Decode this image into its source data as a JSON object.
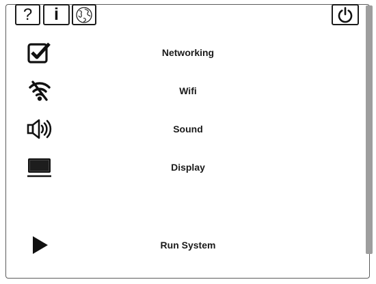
{
  "toolbar": {
    "help_label": "?",
    "info_label": "i"
  },
  "icons": {
    "help": "question-mark-icon",
    "info": "info-icon",
    "language": "globe-icon",
    "power": "power-icon",
    "networking": "checkbox-checked-icon",
    "wifi": "wifi-off-icon",
    "sound": "speaker-volume-icon",
    "display": "monitor-icon",
    "run": "play-icon"
  },
  "menu": {
    "networking": "Networking",
    "wifi": "Wifi",
    "sound": "Sound",
    "display": "Display",
    "run": "Run System"
  }
}
